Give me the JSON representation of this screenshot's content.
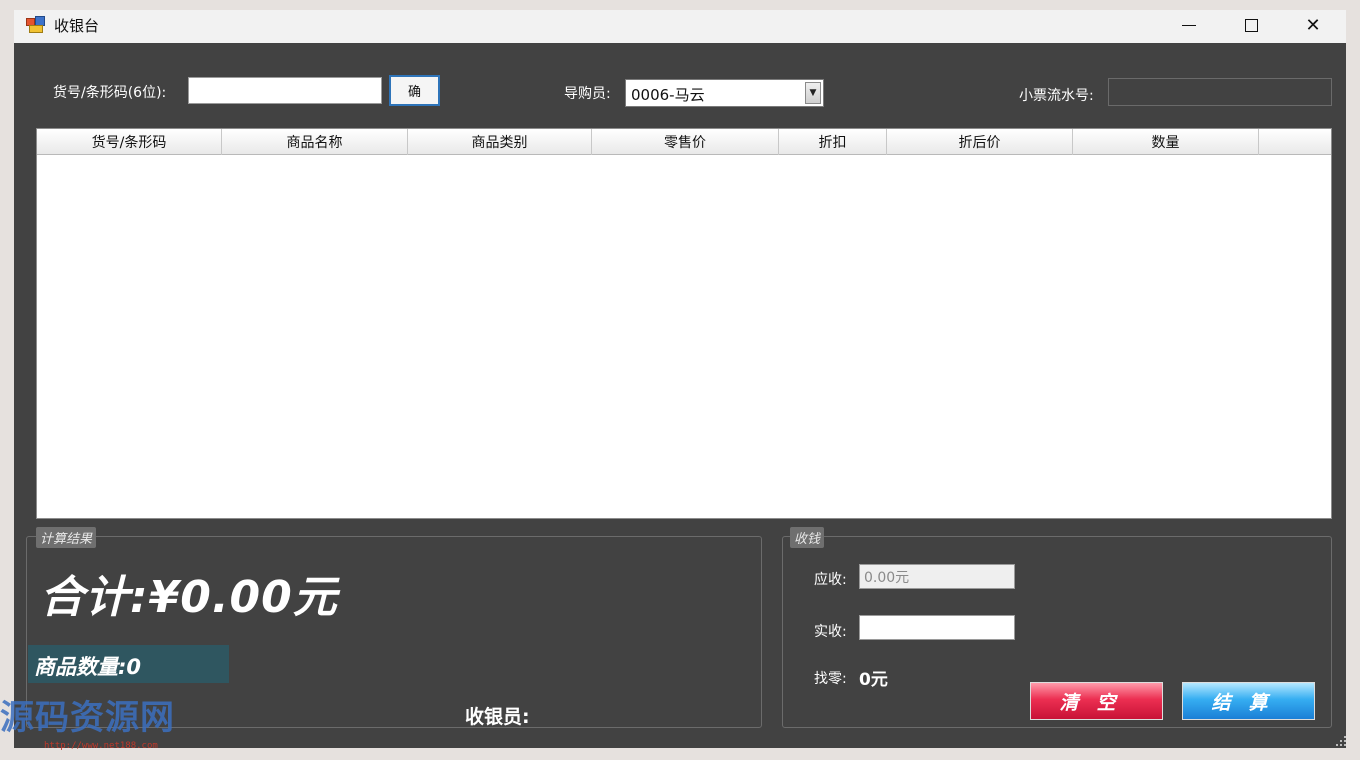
{
  "window": {
    "title": "收银台",
    "icons": {
      "app": "app-logo-icon",
      "minimize": "minimize-icon",
      "maximize": "maximize-icon",
      "close": "close-icon"
    },
    "close_glyph": "✕"
  },
  "toolbar": {
    "barcode_label": "货号/条形码(6位):",
    "barcode_value": "",
    "confirm_label": "确",
    "guide_label": "导购员:",
    "guide_selected": "0006-马云",
    "receipt_label": "小票流水号:",
    "receipt_value": ""
  },
  "grid": {
    "columns": [
      "货号/条形码",
      "商品名称",
      "商品类别",
      "零售价",
      "折扣",
      "折后价",
      "数量",
      ""
    ],
    "rows": []
  },
  "result": {
    "group_title": "计算结果",
    "total_text": "合计:¥0.00元",
    "qty_text": "商品数量:0",
    "cashier_label": "收银员:",
    "cashier_value": ""
  },
  "payment": {
    "group_title": "收钱",
    "due_label": "应收:",
    "due_value": "0.00元",
    "paid_label": "实收:",
    "paid_value": "",
    "change_label": "找零:",
    "change_value": "0元",
    "clear_label": "清空",
    "settle_label": "结算"
  },
  "watermark": {
    "text": "源码资源网",
    "url": "http://www.net188.com"
  },
  "colors": {
    "window_bg": "#424242",
    "qty_bg": "#2f5660",
    "clear_btn": "#ec2f52",
    "settle_btn": "#36aef2"
  }
}
